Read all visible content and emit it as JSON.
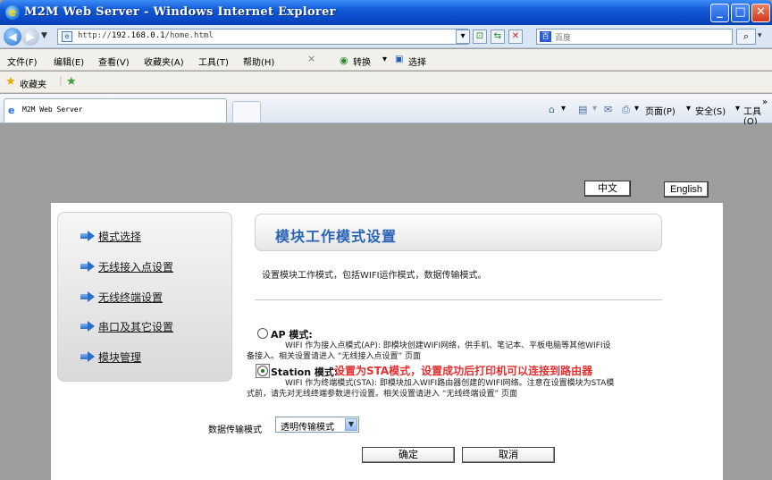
{
  "window": {
    "title": "M2M Web Server - Windows Internet Explorer"
  },
  "addressbar": {
    "url_prefix": "http://",
    "url_host": "192.168.0.1",
    "url_path": "/home.html",
    "search_text": "百度"
  },
  "menu": [
    "文件(F)",
    "编辑(E)",
    "查看(V)",
    "收藏夹(A)",
    "工具(T)",
    "帮助(H)"
  ],
  "menu_extra": {
    "close": "×",
    "convert": "转换",
    "select": "选择"
  },
  "favorites": {
    "label": "收藏夹"
  },
  "tab": {
    "title": "M2M Web Server"
  },
  "command_bar": {
    "page": "页面(P)",
    "safety": "安全(S)",
    "tools": "工具(O)",
    "more": "»"
  },
  "lang": {
    "zh": "中文",
    "en": "English"
  },
  "nav": [
    {
      "label": "模式选择"
    },
    {
      "label": "无线接入点设置"
    },
    {
      "label": "无线终端设置"
    },
    {
      "label": "串口及其它设置"
    },
    {
      "label": "模块管理"
    }
  ],
  "main": {
    "title": "模块工作模式设置",
    "description": "设置模块工作模式，包括WIFI运作模式，数据传输模式。",
    "ap": {
      "label": "AP 模式:",
      "desc_line1": "WIFI 作为接入点模式(AP): 即模块创建WIFI网络，供手机、笔记本、平板电脑等其他WIFI设",
      "desc_line2": "备接入。相关设置请进入 “无线接入点设置” 页面",
      "selected": false
    },
    "station": {
      "label": "Station 模式:",
      "note": "设置为STA模式，设置成功后打印机可以连接到路由器",
      "desc_line1": "WIFI 作为终端模式(STA): 即模块加入WIFI路由器创建的WIFI网络。注意在设置模块为STA模",
      "desc_line2": "式前，请先对无线终端参数进行设置。相关设置请进入 “无线终端设置” 页面",
      "selected": true
    },
    "transfer": {
      "label": "数据传输模式",
      "value": "透明传输模式"
    },
    "buttons": {
      "ok": "确定",
      "cancel": "取消"
    }
  }
}
